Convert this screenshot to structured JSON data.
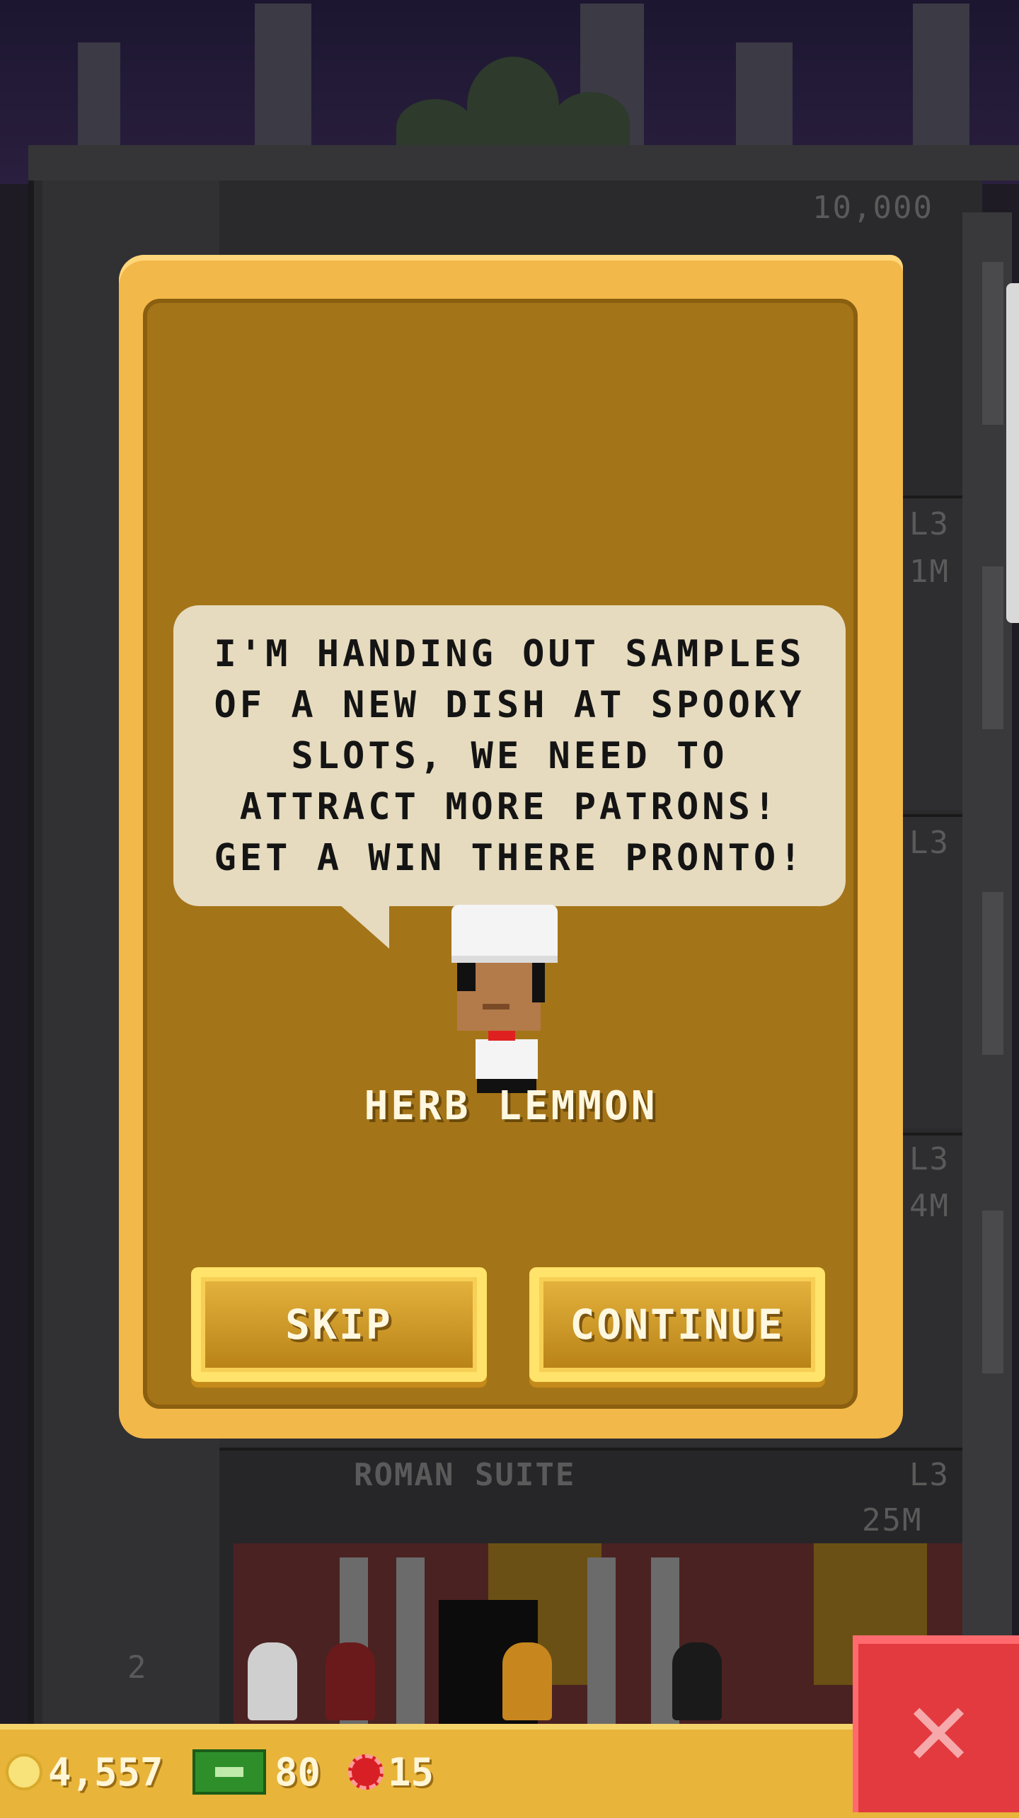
{
  "dialog": {
    "message_lines": [
      "I'M HANDING OUT SAMPLES",
      "OF A NEW DISH AT SPOOKY",
      "SLOTS, WE NEED TO",
      "ATTRACT MORE PATRONS!",
      "GET A WIN THERE PRONTO!"
    ],
    "npc_name": "HERB LEMMON",
    "skip_label": "SKIP",
    "continue_label": "CONTINUE"
  },
  "tower": {
    "top_price": "10,000",
    "floor_name": "ROMAN SUITE",
    "floor_level": "L3",
    "floor_price": "25M",
    "side_labels": [
      "L3",
      "1M",
      "L3",
      "L3",
      "4M"
    ],
    "floor_number": "2"
  },
  "hud": {
    "coins": "4,557",
    "bux": "80",
    "chips": "15"
  },
  "icons": {
    "coin": "coin-icon",
    "bux": "tower-bux-icon",
    "chip": "casino-chip-icon",
    "close": "close-icon"
  },
  "colors": {
    "dialog_frame": "#f3b84a",
    "dialog_panel": "#a47418",
    "bubble": "#e6dbbf",
    "hud_bar": "#e8b43a",
    "close_button": "#e23a3e"
  }
}
